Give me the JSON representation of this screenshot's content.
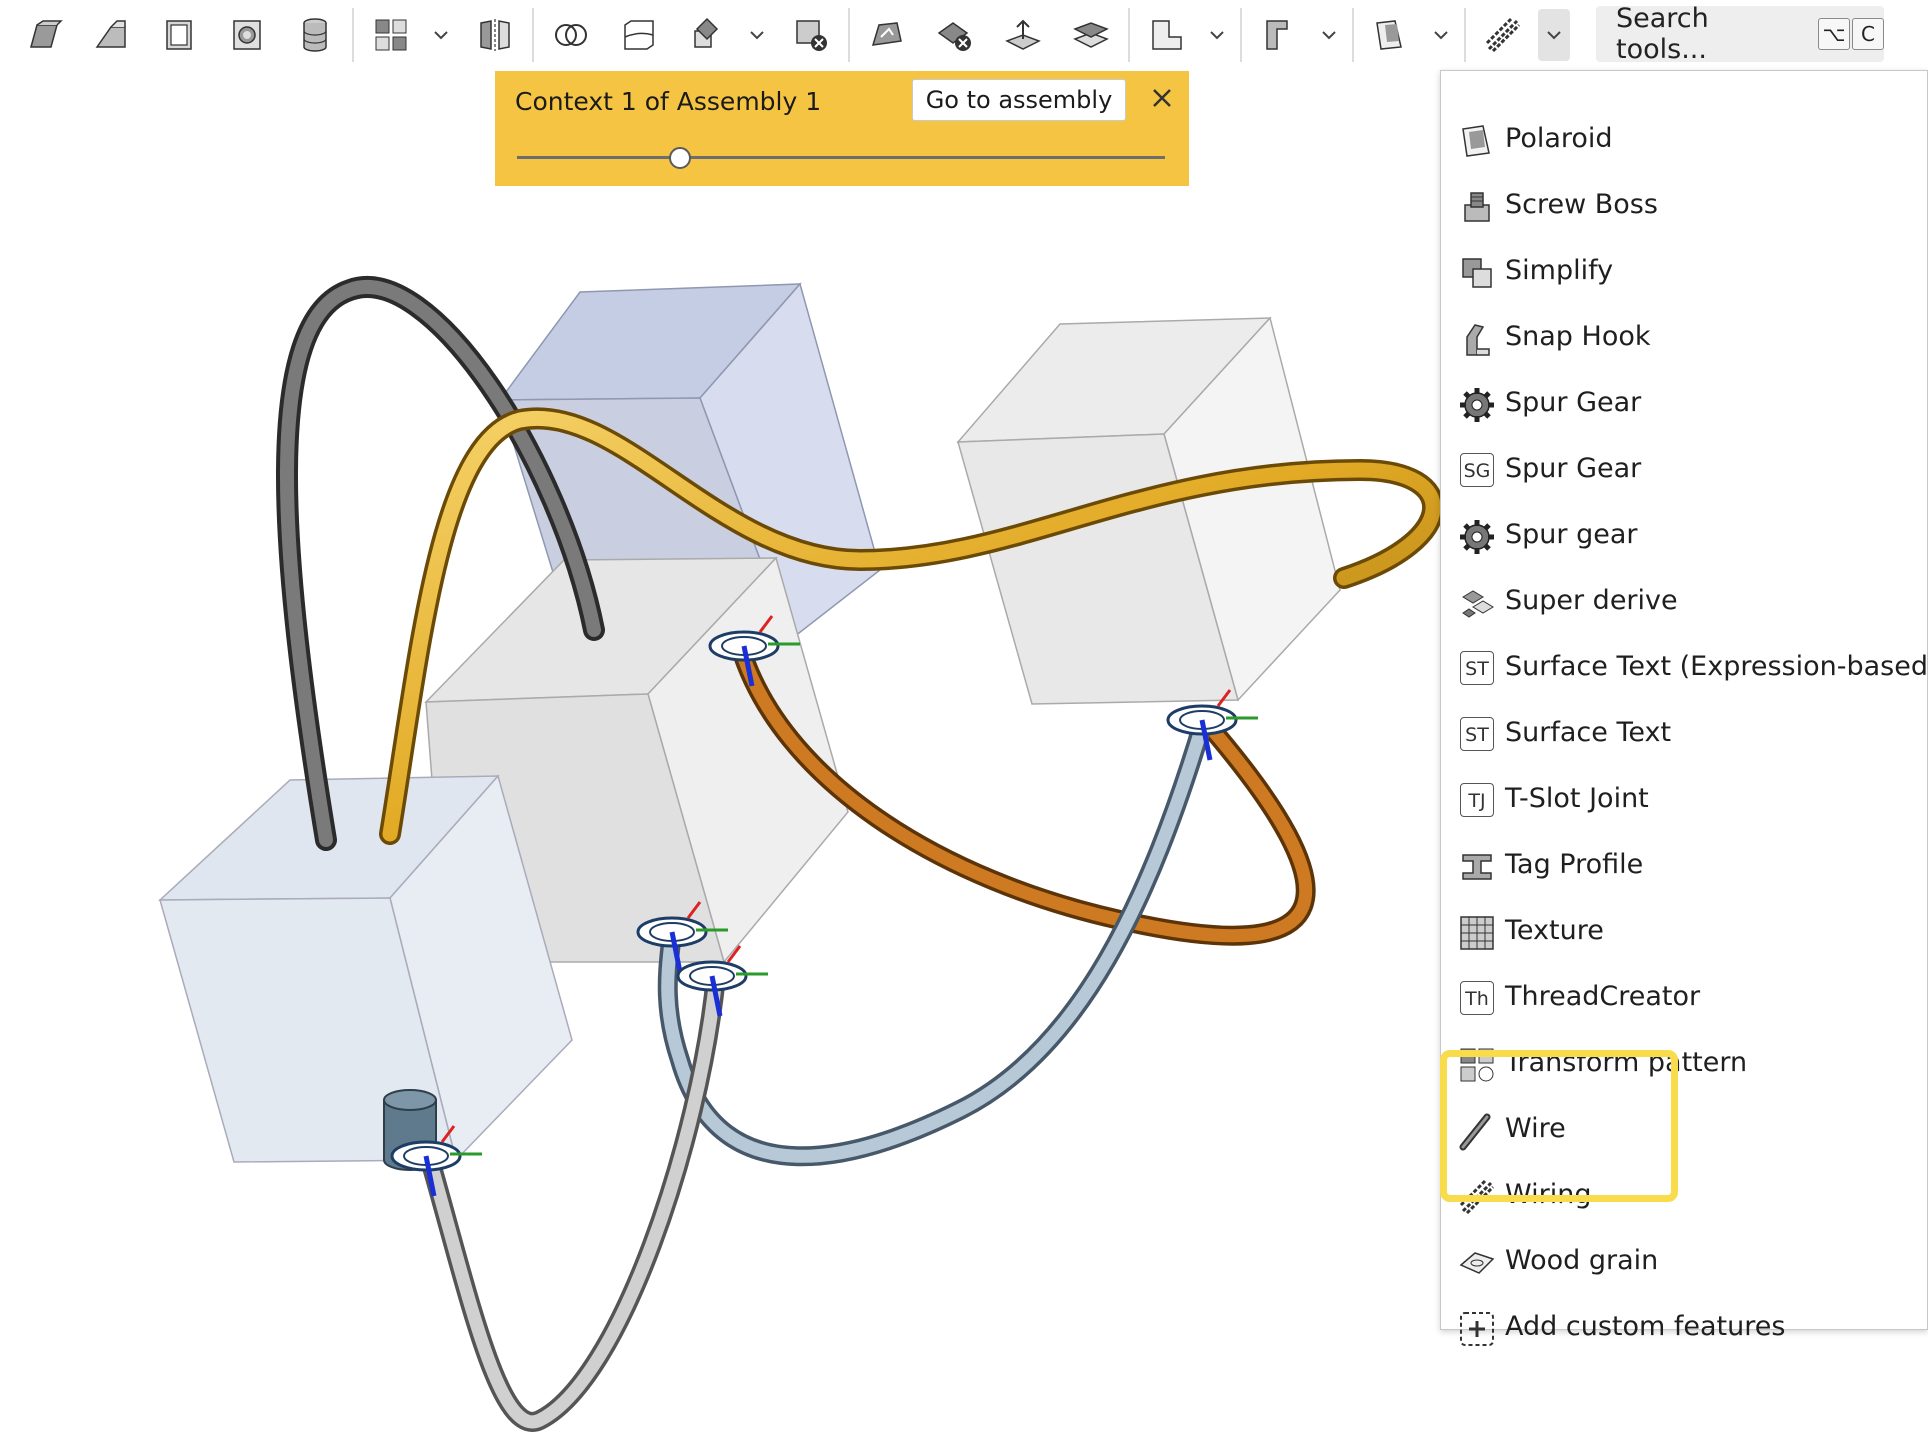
{
  "toolbar": {
    "buttons": [
      {
        "name": "extrude-icon"
      },
      {
        "name": "revolve-icon"
      },
      {
        "name": "sweep-icon"
      },
      {
        "name": "loft-icon"
      },
      {
        "name": "thicken-icon"
      },
      {
        "name": "pattern-icon"
      },
      {
        "name": "mirror-icon"
      },
      {
        "name": "boolean-icon"
      },
      {
        "name": "split-icon"
      },
      {
        "name": "transform-icon"
      },
      {
        "name": "delete-part-icon"
      },
      {
        "name": "modify-fillet-icon"
      },
      {
        "name": "delete-face-icon"
      },
      {
        "name": "move-face-icon"
      },
      {
        "name": "replace-face-icon"
      },
      {
        "name": "sheet-metal-icon"
      },
      {
        "name": "frame-icon"
      },
      {
        "name": "polaroid-icon"
      },
      {
        "name": "wiring-icon"
      }
    ],
    "search": {
      "placeholder": "Search tools...",
      "shortcut_key1": "⌥",
      "shortcut_key2": "C"
    }
  },
  "context_banner": {
    "title": "Context 1 of Assembly 1",
    "goto_label": "Go to assembly",
    "slider_fraction": 0.25
  },
  "menu": {
    "items": [
      {
        "label": "Polaroid",
        "icon": "polaroid-icon"
      },
      {
        "label": "Screw Boss",
        "icon": "screw-boss-icon"
      },
      {
        "label": "Simplify",
        "icon": "simplify-icon"
      },
      {
        "label": "Snap Hook",
        "icon": "snap-hook-icon"
      },
      {
        "label": "Spur Gear",
        "icon": "gear-icon"
      },
      {
        "label": "Spur Gear",
        "icon": "sg-badge-icon",
        "badge": "SG"
      },
      {
        "label": "Spur gear",
        "icon": "gear-icon"
      },
      {
        "label": "Super derive",
        "icon": "super-derive-icon"
      },
      {
        "label": "Surface Text (Expression-based)",
        "icon": "st-badge-icon",
        "badge": "ST"
      },
      {
        "label": "Surface Text",
        "icon": "st-badge-icon",
        "badge": "ST"
      },
      {
        "label": "T-Slot Joint",
        "icon": "tj-badge-icon",
        "badge": "TJ"
      },
      {
        "label": "Tag Profile",
        "icon": "tag-profile-icon"
      },
      {
        "label": "Texture",
        "icon": "texture-icon"
      },
      {
        "label": "ThreadCreator",
        "icon": "th-badge-icon",
        "badge": "Th"
      },
      {
        "label": "Transform pattern",
        "icon": "transform-pattern-icon"
      },
      {
        "label": "Wire",
        "icon": "wire-icon"
      },
      {
        "label": "Wiring",
        "icon": "wiring-icon"
      },
      {
        "label": "Wood grain",
        "icon": "wood-grain-icon"
      },
      {
        "label": "Add custom features",
        "icon": "add-custom-icon"
      }
    ]
  },
  "colors": {
    "banner": "#f6c443",
    "highlight": "#f8dc4c",
    "wire_gold": "#e8b22c",
    "wire_orange": "#c9731c",
    "wire_blue": "#9fb4c4",
    "wire_gray": "#c2c2c2",
    "wire_dark": "#5a5a5a"
  }
}
